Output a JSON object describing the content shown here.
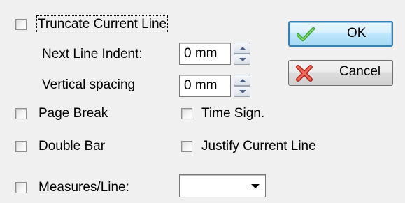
{
  "options": {
    "truncate_label": "Truncate Current Line",
    "next_indent_label": "Next Line Indent:",
    "next_indent_value": "0 mm",
    "vertical_spacing_label": "Vertical spacing",
    "vertical_spacing_value": "0 mm",
    "page_break_label": "Page Break",
    "time_sign_label": "Time Sign.",
    "double_bar_label": "Double Bar",
    "justify_label": "Justify Current Line",
    "measures_label": "Measures/Line:",
    "measures_value": ""
  },
  "buttons": {
    "ok_label": "OK",
    "cancel_label": "Cancel"
  },
  "colors": {
    "dialog_bg": "#f0f0f0",
    "ok_icon": "#3aa73a",
    "cancel_icon": "#d63b2c"
  },
  "icons": {
    "ok": "green-checkmark",
    "cancel": "red-x"
  }
}
